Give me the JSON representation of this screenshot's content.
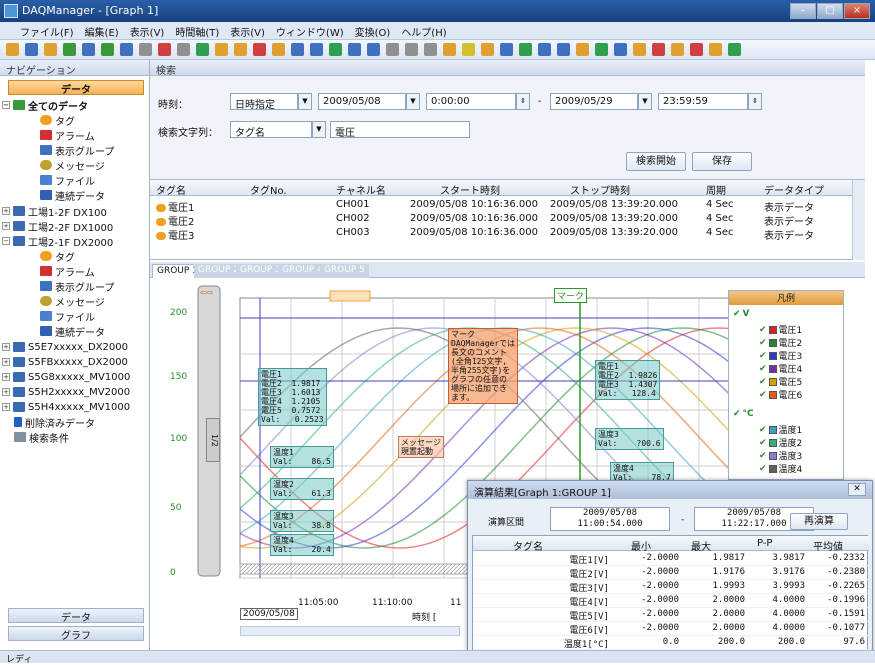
{
  "window": {
    "title": "DAQManager - [Graph 1]"
  },
  "menu": [
    "ファイル(F)",
    "編集(E)",
    "表示(V)",
    "時間軸(T)",
    "表示(V)",
    "ウィンドウ(W)",
    "変換(O)",
    "ヘルプ(H)"
  ],
  "nav": {
    "panel_title": "ナビゲーション",
    "data_header": "データ",
    "data_button": "データ",
    "graph_button": "グラフ",
    "items": [
      "全てのデータ",
      "タグ",
      "アラーム",
      "表示グループ",
      "メッセージ",
      "ファイル",
      "連続データ",
      "工場1-2F DX100",
      "工場2-2F DX1000",
      "工場2-1F DX2000",
      "タグ",
      "アラーム",
      "表示グループ",
      "メッセージ",
      "ファイル",
      "連続データ",
      "S5E7xxxxx_DX2000",
      "S5FBxxxxx_DX2000",
      "S5G8xxxxx_MV1000",
      "S5H2xxxxx_MV2000",
      "S5H4xxxxx_MV1000",
      "削除済みデータ",
      "検索条件"
    ]
  },
  "search": {
    "panel_title": "検索",
    "time_label": "時刻：",
    "time_mode": "日時指定",
    "start_date": "2009/05/08",
    "start_time": "0:00:00",
    "dash": "-",
    "end_date": "2009/05/29",
    "end_time": "23:59:59",
    "string_label": "検索文字列：",
    "string_mode": "タグ名",
    "string_value": "電圧",
    "search_button": "検索開始",
    "save_button": "保存"
  },
  "table": {
    "headers": [
      "タグ名",
      "タグNo.",
      "チャネル名",
      "スタート時刻",
      "ストップ時刻",
      "周期",
      "データタイプ"
    ],
    "rows": [
      [
        "電圧1",
        "",
        "CH001",
        "2009/05/08 10:16:36.000",
        "2009/05/08 13:39:20.000",
        "4 Sec",
        "表示データ"
      ],
      [
        "電圧2",
        "",
        "CH002",
        "2009/05/08 10:16:36.000",
        "2009/05/08 13:39:20.000",
        "4 Sec",
        "表示データ"
      ],
      [
        "電圧3",
        "",
        "CH003",
        "2009/05/08 10:16:36.000",
        "2009/05/08 13:39:20.000",
        "4 Sec",
        "表示データ"
      ]
    ]
  },
  "groups": [
    "GROUP 1",
    "GROUP 2",
    "GROUP 3",
    "GROUP 4",
    "GROUP 5"
  ],
  "chart": {
    "yticks": [
      "200",
      "150",
      "100",
      "50",
      "0"
    ],
    "xticks": [
      "11:05:00",
      "11:10:00",
      "11"
    ],
    "date": "2009/05/08",
    "x_label": "時刻 [",
    "marker_label": "マーク",
    "memo": "マーク\nDAQManagerでは\n長文のコメント\n(全角125文字,\n半角255文字)を\nグラフの任意の\n場所に追加でき\nます。",
    "message": "メッセージ\n現置起動",
    "left_callout": "電圧1\n電圧2  1.9817\n電圧3  1.6013\n電圧4  1.2105\n電圧5  0.7572\nVal:   0.2523",
    "left_temp1": "温度1\nVal:    86.5",
    "left_temp2": "温度2\nVal:    61.3",
    "left_temp3": "温度3\nVal:    38.8",
    "left_temp4": "温度4\nVal:    20.4",
    "right_callout": "電圧1\n電圧2  1.9826\n電圧3  1.4307\nVal:   128.4",
    "right_temp3": "温度3\nVal:    ?00.6",
    "right_temp4": "温度4\nVal:    78.7",
    "cursor_label": "1/2"
  },
  "legend": {
    "title": "凡例",
    "unit_v": "V",
    "unit_c": "°C",
    "volts": [
      "電圧1",
      "電圧2",
      "電圧3",
      "電圧4",
      "電圧5",
      "電圧6"
    ],
    "temps": [
      "温度1",
      "温度2",
      "温度3",
      "温度4"
    ],
    "volt_colors": [
      "#e02020",
      "#1a8a2a",
      "#2a3ad0",
      "#7a2ab0",
      "#d0a000",
      "#e06010"
    ],
    "temp_colors": [
      "#40a0c0",
      "#30b070",
      "#8080d0",
      "#606060"
    ]
  },
  "calc": {
    "title": "演算結果[Graph 1:GROUP 1]",
    "range_label": "演算区間",
    "from": "2009/05/08\n11:00:54.000",
    "dash": "-",
    "to": "2009/05/08\n11:22:17.000",
    "recalc_button": "再演算",
    "headers": [
      "タグ名",
      "最小",
      "最大",
      "P-P",
      "平均値"
    ],
    "rows": [
      [
        "電圧1[V]",
        "-2.0000",
        "1.9817",
        "3.9817",
        "-0.2332"
      ],
      [
        "電圧2[V]",
        "-2.0000",
        "1.9176",
        "3.9176",
        "-0.2380"
      ],
      [
        "電圧3[V]",
        "-2.0000",
        "1.9993",
        "3.9993",
        "-0.2265"
      ],
      [
        "電圧4[V]",
        "-2.0000",
        "2.0000",
        "4.0000",
        "-0.1996"
      ],
      [
        "電圧5[V]",
        "-2.0000",
        "2.0000",
        "4.0000",
        "-0.1591"
      ],
      [
        "電圧6[V]",
        "-2.0000",
        "2.0000",
        "4.0000",
        "-0.1077"
      ],
      [
        "温度1[°C]",
        "0.0",
        "200.0",
        "200.0",
        "97.6"
      ]
    ]
  },
  "status": "レディ"
}
